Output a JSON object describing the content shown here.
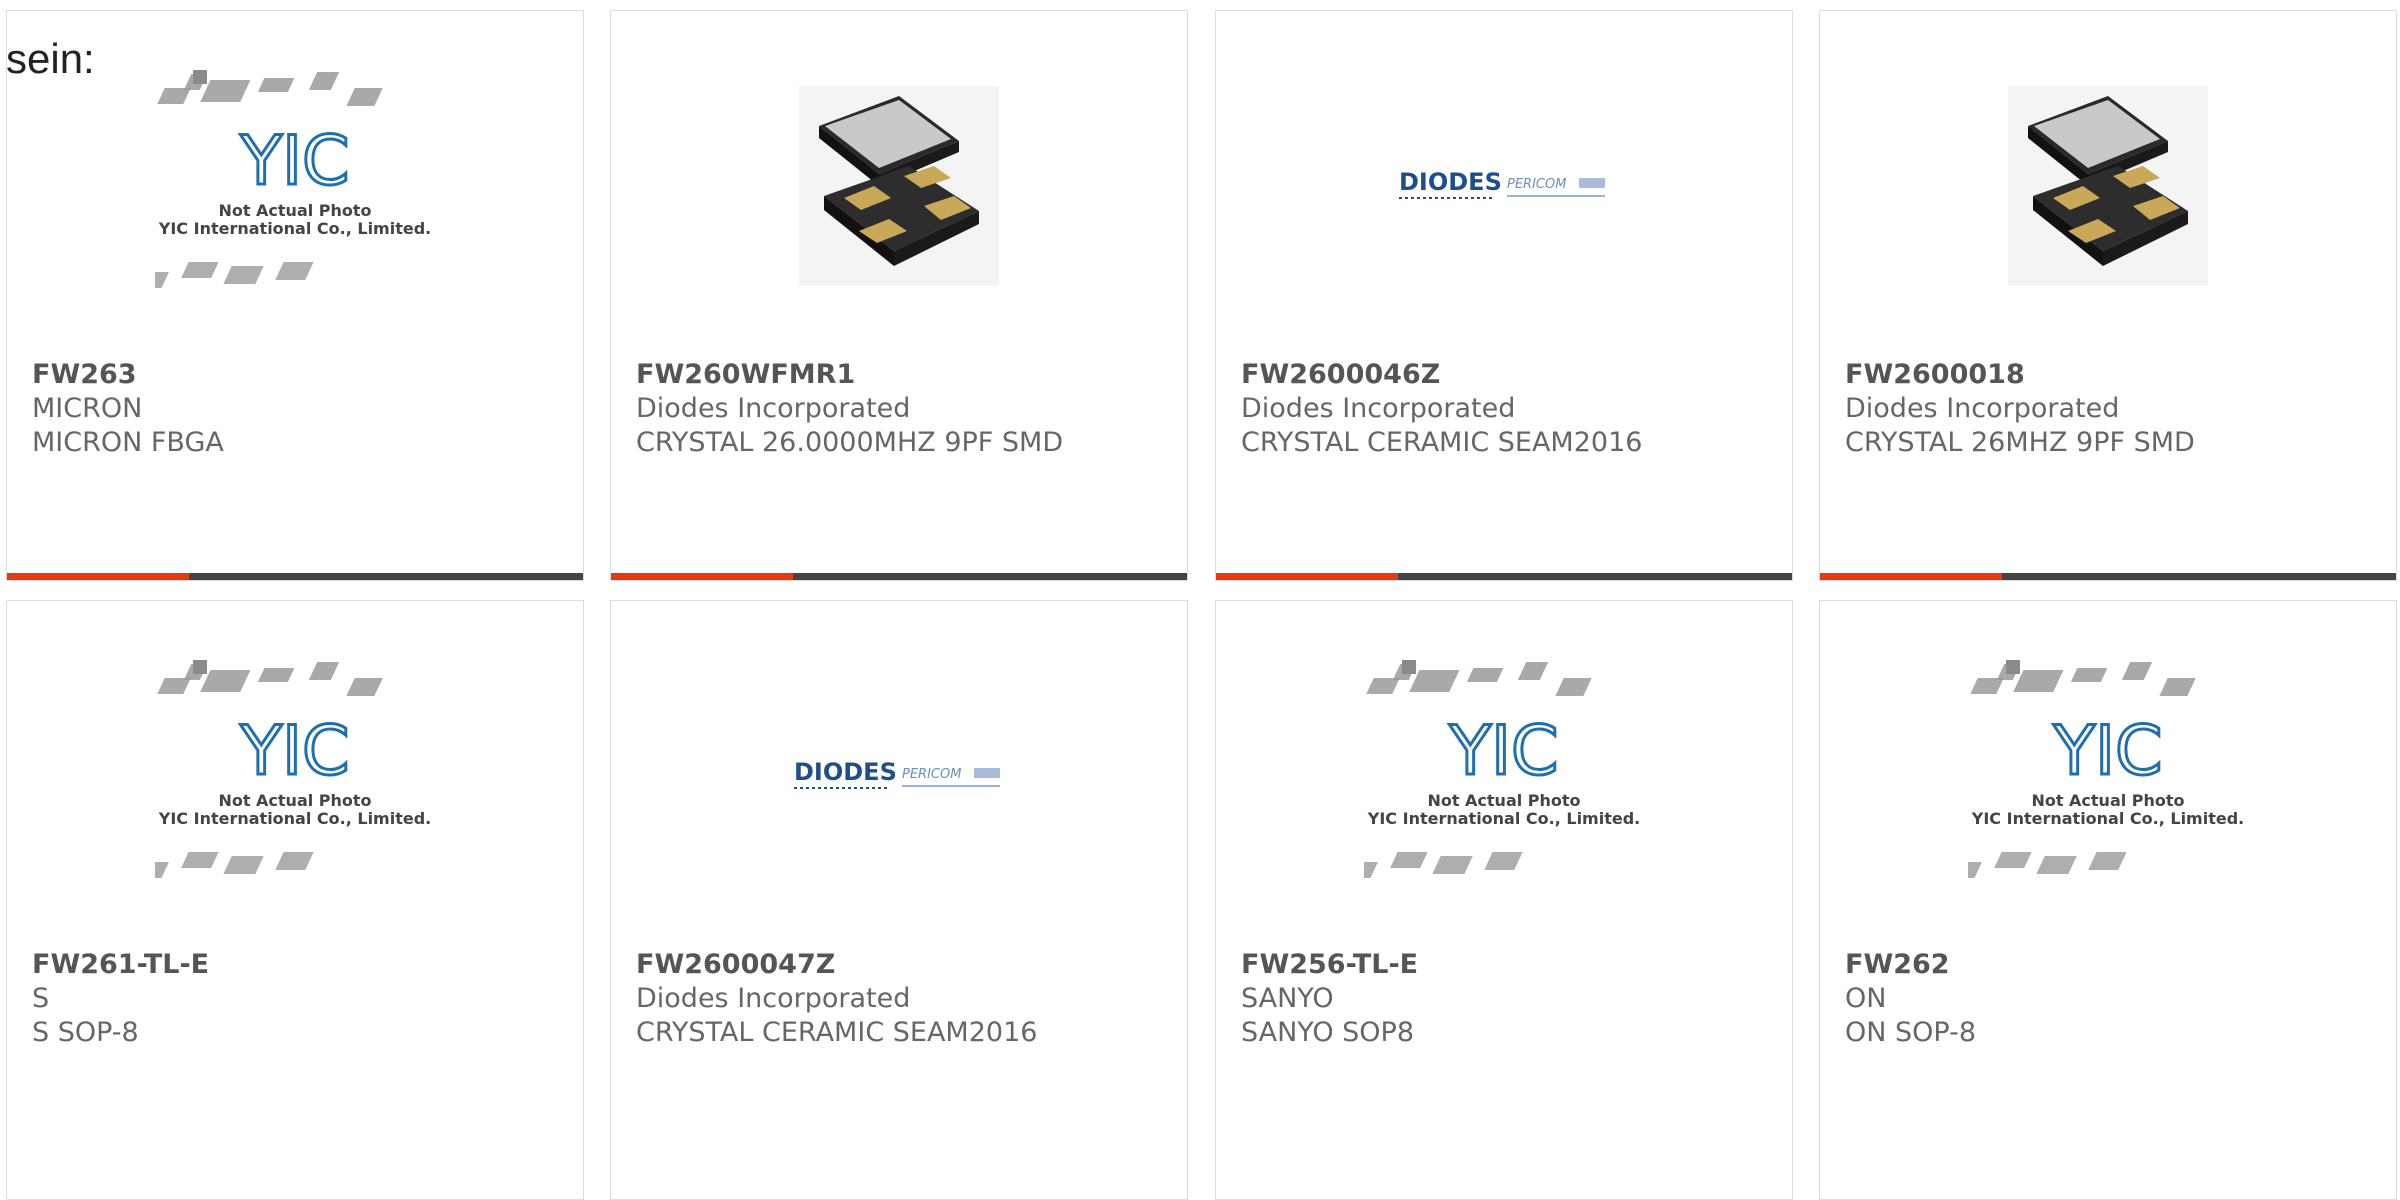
{
  "intro_text": "sein:",
  "colors": {
    "accent": "#e33a12",
    "bar_dark": "#444444",
    "border": "#dcdcdc"
  },
  "placeholder": {
    "line1": "Not Actual Photo",
    "line2": "YIC International Co., Limited.",
    "logo": "YIC"
  },
  "diodes_logo": {
    "brand": "DIODES",
    "partner": "PERICOM"
  },
  "products": [
    {
      "part": "FW263",
      "manufacturer": "MICRON",
      "description": "MICRON FBGA",
      "image": "yic-placeholder",
      "bar": true
    },
    {
      "part": "FW260WFMR1",
      "manufacturer": "Diodes Incorporated",
      "description": "CRYSTAL 26.0000MHZ 9PF SMD",
      "image": "crystal-package",
      "bar": true
    },
    {
      "part": "FW2600046Z",
      "manufacturer": "Diodes Incorporated",
      "description": "CRYSTAL CERAMIC SEAM2016",
      "image": "diodes-logo",
      "bar": true
    },
    {
      "part": "FW2600018",
      "manufacturer": "Diodes Incorporated",
      "description": "CRYSTAL 26MHZ 9PF SMD",
      "image": "crystal-package",
      "bar": true
    },
    {
      "part": "FW261-TL-E",
      "manufacturer": "S",
      "description": "S SOP-8",
      "image": "yic-placeholder",
      "bar": false
    },
    {
      "part": "FW2600047Z",
      "manufacturer": "Diodes Incorporated",
      "description": "CRYSTAL CERAMIC SEAM2016",
      "image": "diodes-logo",
      "bar": false
    },
    {
      "part": "FW256-TL-E",
      "manufacturer": "SANYO",
      "description": "SANYO SOP8",
      "image": "yic-placeholder",
      "bar": false
    },
    {
      "part": "FW262",
      "manufacturer": "ON",
      "description": "ON SOP-8",
      "image": "yic-placeholder",
      "bar": false
    }
  ]
}
